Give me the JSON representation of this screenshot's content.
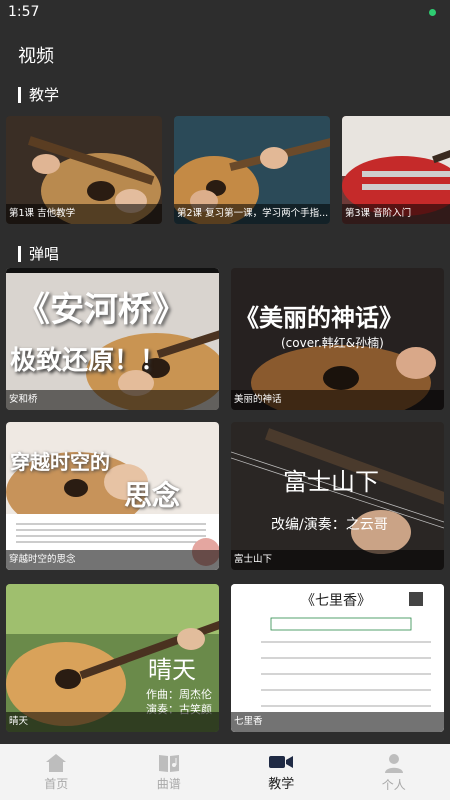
{
  "status": {
    "time": "1:57"
  },
  "page_title": "视频",
  "sections": {
    "teaching": "教学",
    "playing": "弹唱"
  },
  "lessons": [
    {
      "caption": "第1课 吉他教学"
    },
    {
      "caption": "第2课 复习第一课，学习两个手指..."
    },
    {
      "caption": "第3课 音阶入门"
    }
  ],
  "songs": [
    {
      "caption": "安和桥",
      "overlay_line1": "《安河桥》",
      "overlay_line2": "极致还原！！"
    },
    {
      "caption": "美丽的神话",
      "overlay_line1": "《美丽的神话》",
      "overlay_line2": "(cover.韩红&孙楠)"
    },
    {
      "caption": "穿越时空的思念",
      "overlay_line1": "穿越时空的",
      "overlay_line2": "思念"
    },
    {
      "caption": "富士山下",
      "overlay_line1": "富士山下",
      "overlay_line2": "改编/演奏：之云哥"
    },
    {
      "caption": "晴天",
      "overlay_line1": "晴天",
      "overlay_line2": "作曲：周杰伦",
      "overlay_line3": "演奏：古笑颜"
    },
    {
      "caption": "七里香",
      "overlay_line1": "《七里香》"
    }
  ],
  "tabs": [
    {
      "label": "首页",
      "icon": "home-icon"
    },
    {
      "label": "曲谱",
      "icon": "score-book-icon"
    },
    {
      "label": "教学",
      "icon": "video-camera-icon",
      "active": true
    },
    {
      "label": "个人",
      "icon": "person-icon"
    }
  ]
}
